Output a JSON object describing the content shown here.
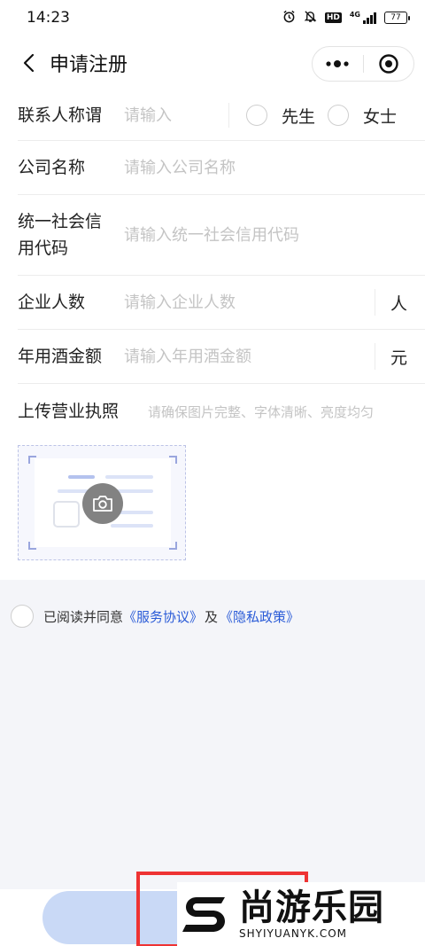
{
  "status_bar": {
    "time": "14:23",
    "icons": [
      "alarm-icon",
      "mute-bell-icon",
      "hd-icon",
      "4g-signal-icon",
      "battery-icon"
    ],
    "hd": "HD",
    "network": "4G",
    "battery": "77"
  },
  "nav": {
    "title": "申请注册",
    "more_icon": "more-dots-icon",
    "close_icon": "target-circle-icon"
  },
  "form": {
    "contact": {
      "label": "联系人称谓",
      "placeholder": "请输入",
      "options": [
        "先生",
        "女士"
      ]
    },
    "company": {
      "label": "公司名称",
      "placeholder": "请输入公司名称"
    },
    "credit_code": {
      "label_line1": "统一社会信",
      "label_line2": "用代码",
      "placeholder": "请输入统一社会信用代码"
    },
    "employees": {
      "label": "企业人数",
      "placeholder": "请输入企业人数",
      "unit": "人"
    },
    "wine_amount": {
      "label": "年用酒金额",
      "placeholder": "请输入年用酒金额",
      "unit": "元"
    },
    "license": {
      "label": "上传营业执照",
      "hint": "请确保图片完整、字体清晰、亮度均匀",
      "icon": "camera-icon"
    }
  },
  "agreement": {
    "prefix": "已阅读并同意",
    "service_link": "《服务协议》",
    "and": "及",
    "privacy_link": "《隐私政策》"
  },
  "colors": {
    "link": "#2a5bd7",
    "submit_bg": "#c9d9f6",
    "page_bg": "#f4f5f9"
  },
  "watermark": {
    "name": "尚游乐园",
    "url": "SHYIYUANYK.COM"
  }
}
